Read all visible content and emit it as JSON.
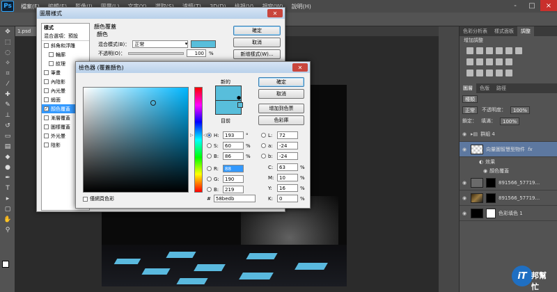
{
  "app": {
    "logo": "Ps",
    "menu": [
      "檔案(F)",
      "編輯(E)",
      "影像(I)",
      "圖層(L)",
      "文字(Y)",
      "選取(S)",
      "濾鏡(T)",
      "3D(D)",
      "檢視(V)",
      "視窗(W)",
      "說明(H)"
    ],
    "doc_tab": "1.psd",
    "window_controls": [
      "-",
      "□",
      "×"
    ]
  },
  "layer_style": {
    "title": "圖層樣式",
    "styles_header": "樣式",
    "blend_options": "混合選項：預設",
    "items": [
      {
        "label": "斜角和浮雕",
        "checked": false,
        "indent": false,
        "selected": false
      },
      {
        "label": "輪廓",
        "checked": false,
        "indent": true,
        "selected": false
      },
      {
        "label": "紋理",
        "checked": false,
        "indent": true,
        "selected": false
      },
      {
        "label": "筆畫",
        "checked": false,
        "indent": false,
        "selected": false
      },
      {
        "label": "內陰影",
        "checked": false,
        "indent": false,
        "selected": false
      },
      {
        "label": "內光暈",
        "checked": false,
        "indent": false,
        "selected": false
      },
      {
        "label": "緞面",
        "checked": false,
        "indent": false,
        "selected": false
      },
      {
        "label": "顏色覆蓋",
        "checked": true,
        "indent": false,
        "selected": true
      },
      {
        "label": "漸層覆蓋",
        "checked": false,
        "indent": false,
        "selected": false
      },
      {
        "label": "圖樣覆蓋",
        "checked": false,
        "indent": false,
        "selected": false
      },
      {
        "label": "外光暈",
        "checked": false,
        "indent": false,
        "selected": false
      },
      {
        "label": "陰影",
        "checked": false,
        "indent": false,
        "selected": false
      }
    ],
    "group_title": "顏色覆蓋",
    "sub_title": "顏色",
    "blend_mode_label": "混合模式(B)：",
    "blend_mode_value": "正常",
    "opacity_label": "不透明(O)：",
    "opacity_value": "100",
    "opacity_unit": "%",
    "buttons": {
      "ok": "確定",
      "cancel": "取消",
      "new_style": "新增樣式(W)..."
    }
  },
  "color_picker": {
    "title": "檢色器 (覆蓋顏色)",
    "new_label": "新的",
    "current_label": "目前",
    "buttons": {
      "ok": "確定",
      "cancel": "取消",
      "add_swatch": "增加到色票",
      "libraries": "色彩庫"
    },
    "hsb": [
      {
        "label": "H:",
        "value": "193",
        "unit": "°",
        "selected": true
      },
      {
        "label": "S:",
        "value": "60",
        "unit": "%",
        "selected": false
      },
      {
        "label": "B:",
        "value": "86",
        "unit": "%",
        "selected": false
      }
    ],
    "rgb": [
      {
        "label": "R:",
        "value": "88",
        "highlighted": true
      },
      {
        "label": "G:",
        "value": "190",
        "highlighted": false
      },
      {
        "label": "B:",
        "value": "219",
        "highlighted": false
      }
    ],
    "lab": [
      {
        "label": "L:",
        "value": "72"
      },
      {
        "label": "a:",
        "value": "-24"
      },
      {
        "label": "b:",
        "value": "-24"
      }
    ],
    "cmyk": [
      {
        "label": "C:",
        "value": "63",
        "unit": "%"
      },
      {
        "label": "M:",
        "value": "10",
        "unit": "%"
      },
      {
        "label": "Y:",
        "value": "16",
        "unit": "%"
      },
      {
        "label": "K:",
        "value": "0",
        "unit": "%"
      }
    ],
    "hex_prefix": "#",
    "hex_value": "58bedb",
    "web_only_label": "僅網頁色彩",
    "current_color": "#58bedb"
  },
  "right_panel": {
    "top_tabs": [
      "色彩分析表",
      "樣式面板",
      "調整"
    ],
    "adjust_title": "增加調整",
    "layer_tabs": [
      "圖層",
      "色版",
      "路徑"
    ],
    "kind_label": "種類",
    "blend_mode": "正常",
    "opacity_label": "不透明度：",
    "opacity_value": "100%",
    "lock_label": "鎖定：",
    "fill_label": "填滿：",
    "fill_value": "100%",
    "layers": [
      {
        "name": "群組 4",
        "type": "group",
        "selected": false
      },
      {
        "name": "向量圖智慧型物件",
        "type": "smart",
        "selected": true,
        "fx": "fx"
      },
      {
        "name": "效果",
        "type": "effect-sub",
        "selected": false
      },
      {
        "name": "顏色覆蓋",
        "type": "effect-sub",
        "selected": false
      },
      {
        "name": "891566_57719...",
        "type": "masked",
        "selected": false
      },
      {
        "name": "891566_57719...",
        "type": "masked-photo",
        "selected": false
      },
      {
        "name": "色彩填色 1",
        "type": "fill",
        "selected": false
      }
    ]
  },
  "watermark": {
    "circle_text": "iT",
    "text": "邦幫忙"
  }
}
